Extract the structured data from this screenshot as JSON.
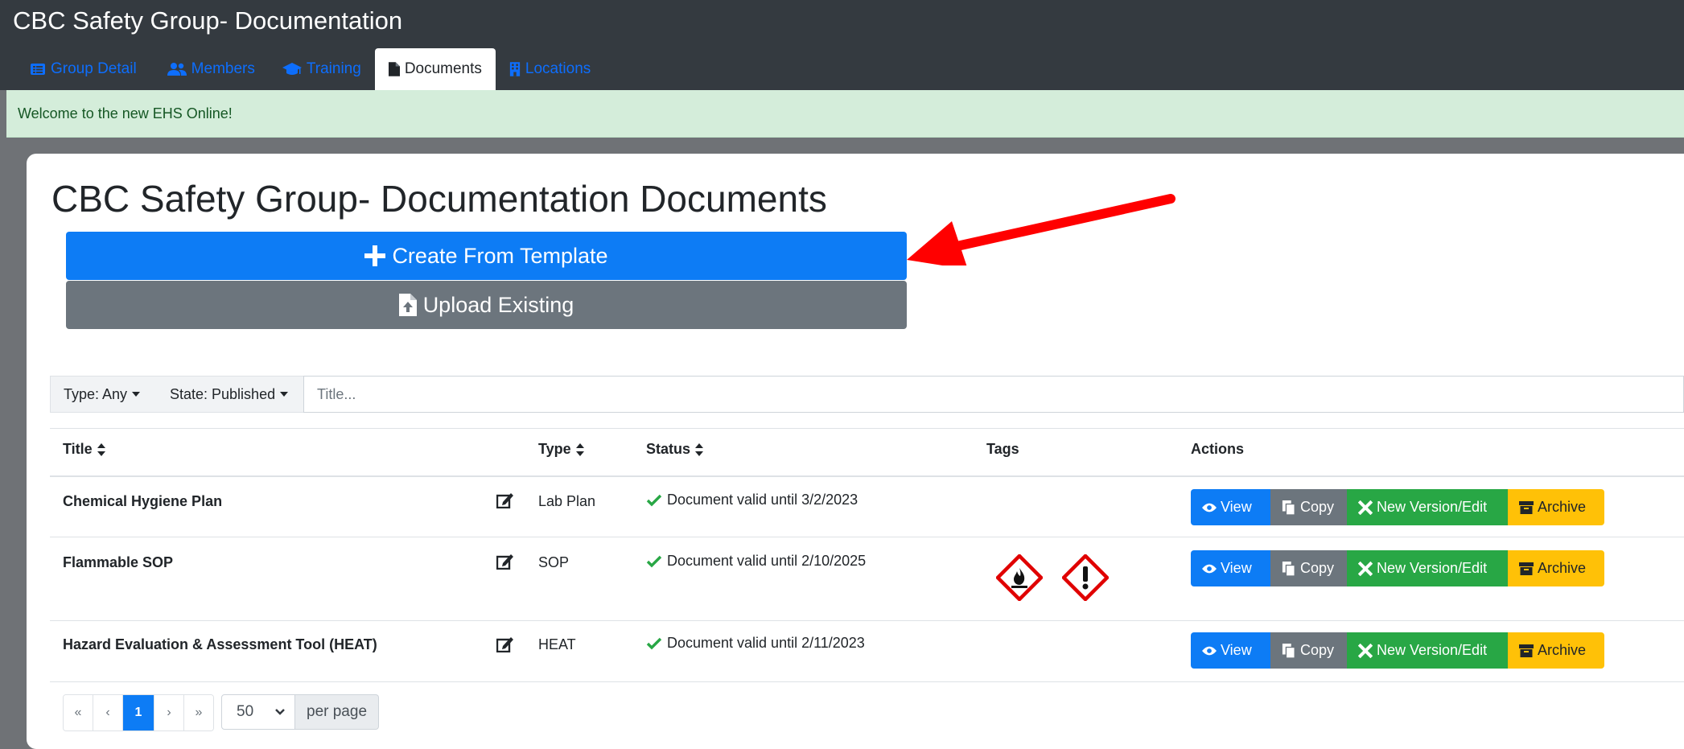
{
  "app": {
    "title": "CBC Safety Group- Documentation"
  },
  "tabs": [
    {
      "label": "Group Detail",
      "icon": "list-icon"
    },
    {
      "label": "Members",
      "icon": "users-icon"
    },
    {
      "label": "Training",
      "icon": "graduation-cap-icon"
    },
    {
      "label": "Documents",
      "icon": "file-icon",
      "active": true
    },
    {
      "label": "Locations",
      "icon": "building-icon"
    }
  ],
  "alert": {
    "text": "Welcome to the new EHS Online!"
  },
  "page": {
    "title": "CBC Safety Group- Documentation Documents"
  },
  "buttons": {
    "create": "Create From Template",
    "upload": "Upload Existing"
  },
  "filters": {
    "type": "Type: Any",
    "state": "State: Published",
    "title_placeholder": "Title..."
  },
  "table": {
    "columns": [
      "Title",
      "Type",
      "Status",
      "Tags",
      "Actions"
    ],
    "rows": [
      {
        "title": "Chemical Hygiene Plan",
        "type": "Lab Plan",
        "status": "Document valid until 3/2/2023",
        "tags": []
      },
      {
        "title": "Flammable SOP",
        "type": "SOP",
        "status": "Document valid until 2/10/2025",
        "tags": [
          "flammable-hazard-icon",
          "exclamation-hazard-icon"
        ]
      },
      {
        "title": "Hazard Evaluation & Assessment Tool (HEAT)",
        "type": "HEAT",
        "status": "Document valid until 2/11/2023",
        "tags": []
      }
    ],
    "actions": {
      "view": "View",
      "copy": "Copy",
      "edit": "New Version/Edit",
      "archive": "Archive"
    }
  },
  "pagination": {
    "first": "«",
    "prev": "‹",
    "current": "1",
    "next": "›",
    "last": "»",
    "per_page_value": "50",
    "per_page_label": "per page"
  },
  "colors": {
    "navbar": "#343a40",
    "primary": "#0d7cf5",
    "secondary": "#6c757d",
    "success": "#28a745",
    "warning": "#ffc107",
    "alert_bg": "#d4edda",
    "alert_text": "#155724",
    "annotation_arrow": "#ff0000",
    "hazard_red": "#e00000"
  }
}
